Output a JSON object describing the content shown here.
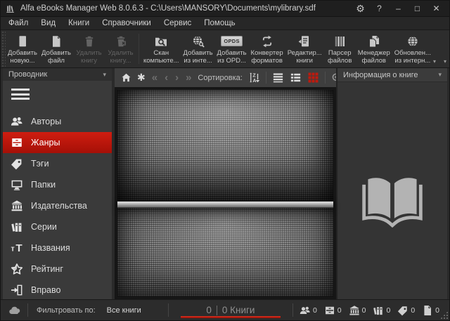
{
  "titlebar": {
    "title": "Alfa eBooks Manager Web 8.0.6.3 - C:\\Users\\MANSORY\\Documents\\mylibrary.sdf",
    "controls": {
      "settings_glyph": "⚙",
      "help_glyph": "?",
      "minimize_glyph": "–",
      "maximize_glyph": "□",
      "close_glyph": "✕"
    }
  },
  "menu": {
    "items": [
      {
        "label": "Файл"
      },
      {
        "label": "Вид"
      },
      {
        "label": "Книги"
      },
      {
        "label": "Справочники"
      },
      {
        "label": "Сервис"
      },
      {
        "label": "Помощь"
      }
    ]
  },
  "toolbar": {
    "overflow_glyph": "▾",
    "buttons": [
      {
        "line1": "Добавить",
        "line2": "новую...",
        "icon": "add-new-book-icon",
        "enabled": true
      },
      {
        "line1": "Добавить",
        "line2": "файл",
        "icon": "add-file-icon",
        "enabled": true
      },
      {
        "line1": "Удалить",
        "line2": "книгу",
        "icon": "delete-book-icon",
        "enabled": false
      },
      {
        "line1": "Удалить",
        "line2": "книгу...",
        "icon": "delete-book-file-icon",
        "enabled": false
      },
      {
        "line1": "Скан",
        "line2": "компьюте...",
        "icon": "scan-computer-icon",
        "enabled": true
      },
      {
        "line1": "Добавить",
        "line2": "из инте...",
        "icon": "add-from-internet-icon",
        "enabled": true
      },
      {
        "line1": "Добавить",
        "line2": "из OPD...",
        "icon": "opds-icon",
        "enabled": true,
        "badge": "OPDS"
      },
      {
        "line1": "Конвертер",
        "line2": "форматов",
        "icon": "format-converter-icon",
        "enabled": true
      },
      {
        "line1": "Редактир...",
        "line2": "книги",
        "icon": "edit-book-icon",
        "enabled": true
      },
      {
        "line1": "Парсер",
        "line2": "файлов",
        "icon": "file-parser-icon",
        "enabled": true
      },
      {
        "line1": "Менеджер",
        "line2": "файлов",
        "icon": "file-manager-icon",
        "enabled": true
      },
      {
        "line1": "Обновлен...",
        "line2": "из интерн...",
        "icon": "update-from-internet-icon",
        "enabled": true
      }
    ]
  },
  "sidebar": {
    "header": "Проводник",
    "dropdown_glyph": "▾",
    "items": [
      {
        "label": "Авторы",
        "icon": "authors-icon",
        "selected": false
      },
      {
        "label": "Жанры",
        "icon": "genres-icon",
        "selected": true
      },
      {
        "label": "Тэги",
        "icon": "tags-icon",
        "selected": false
      },
      {
        "label": "Папки",
        "icon": "folders-icon",
        "selected": false
      },
      {
        "label": "Издательства",
        "icon": "publishers-icon",
        "selected": false
      },
      {
        "label": "Серии",
        "icon": "series-icon",
        "selected": false
      },
      {
        "label": "Названия",
        "icon": "titles-icon",
        "selected": false
      },
      {
        "label": "Рейтинг",
        "icon": "rating-icon",
        "selected": false
      },
      {
        "label": "Вправо",
        "icon": "move-right-icon",
        "selected": false
      }
    ]
  },
  "book_view": {
    "sort_label": "Сортировка:",
    "nav": {
      "asterisk_glyph": "✱",
      "back_double_glyph": "«",
      "back_glyph": "‹",
      "forward_glyph": "›",
      "forward_double_glyph": "»"
    },
    "view_modes": [
      "list-view-icon",
      "detail-view-icon",
      "grid-view-icon"
    ],
    "active_view_color": "#bf1a0e"
  },
  "info_panel": {
    "header": "Информация о книге",
    "dropdown_glyph": "▾"
  },
  "filter_bar": {
    "label": "Фильтровать по:",
    "value": "Все книги"
  },
  "statusbar": {
    "selected_count": "0",
    "books_label": "0 Книги",
    "stats": [
      {
        "icon": "authors-icon",
        "value": "0"
      },
      {
        "icon": "genres-icon",
        "value": "0"
      },
      {
        "icon": "publishers-icon",
        "value": "0"
      },
      {
        "icon": "series-icon",
        "value": "0"
      },
      {
        "icon": "tags-icon",
        "value": "0"
      },
      {
        "icon": "files-icon",
        "value": "0"
      }
    ]
  },
  "colors": {
    "accent_red": "#c3190f",
    "selected_top": "#cf1d10",
    "selected_bottom": "#a51007",
    "progress_red": "#c0170c"
  }
}
